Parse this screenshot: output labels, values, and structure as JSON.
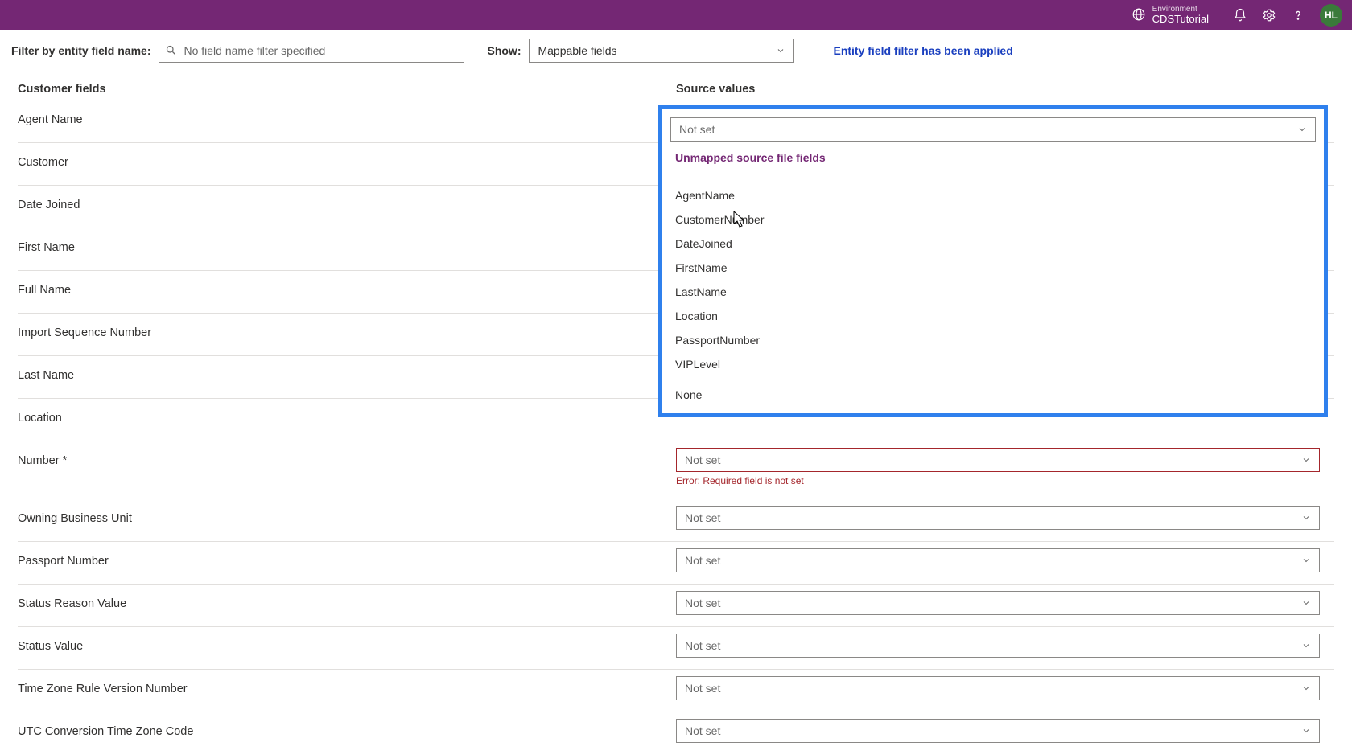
{
  "header": {
    "environment_label": "Environment",
    "environment_name": "CDSTutorial",
    "avatar_initials": "HL"
  },
  "filter": {
    "filter_label": "Filter by entity field name:",
    "filter_placeholder": "No field name filter specified",
    "show_label": "Show:",
    "show_value": "Mappable fields",
    "applied_text": "Entity field filter has been applied"
  },
  "columns": {
    "left": "Customer fields",
    "right": "Source values"
  },
  "dropdown": {
    "selected": "Not set",
    "section_title": "Unmapped source file fields",
    "options": [
      "AgentName",
      "CustomerNumber",
      "DateJoined",
      "FirstName",
      "LastName",
      "Location",
      "PassportNumber",
      "VIPLevel"
    ],
    "none_label": "None"
  },
  "not_set": "Not set",
  "error_required": "Error: Required field is not set",
  "fields": [
    {
      "label": "Agent Name"
    },
    {
      "label": "Customer"
    },
    {
      "label": "Date Joined"
    },
    {
      "label": "First Name"
    },
    {
      "label": "Full Name"
    },
    {
      "label": "Import Sequence Number"
    },
    {
      "label": "Last Name"
    },
    {
      "label": "Location"
    },
    {
      "label": "Number *"
    },
    {
      "label": "Owning Business Unit"
    },
    {
      "label": "Passport Number"
    },
    {
      "label": "Status Reason Value"
    },
    {
      "label": "Status Value"
    },
    {
      "label": "Time Zone Rule Version Number"
    },
    {
      "label": "UTC Conversion Time Zone Code"
    }
  ]
}
